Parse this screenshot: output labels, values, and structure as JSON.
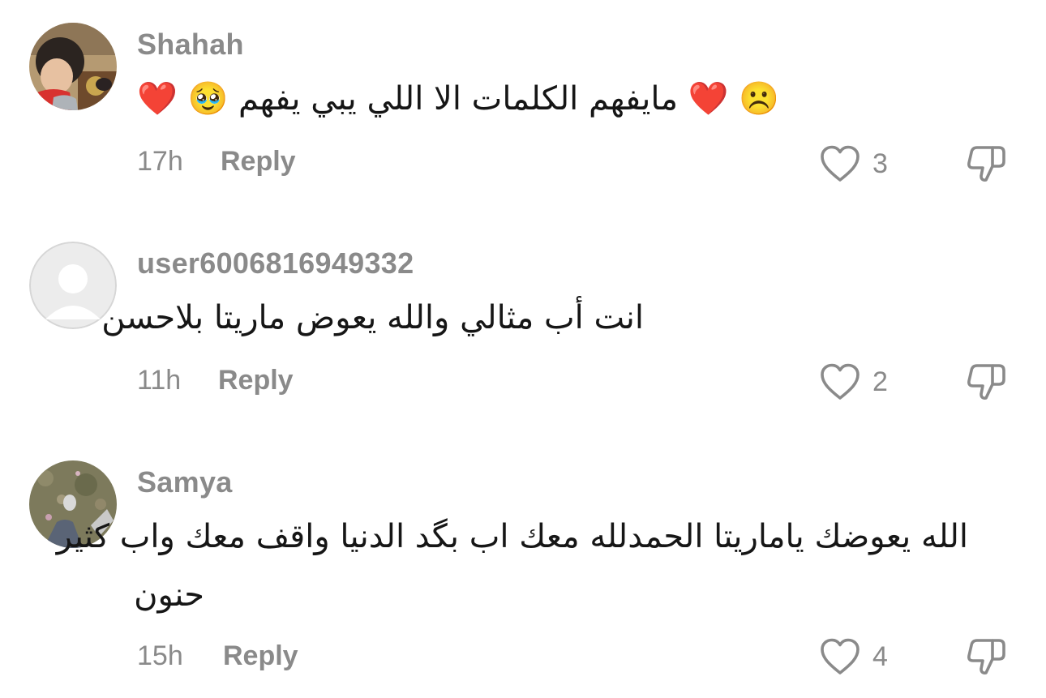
{
  "comments": [
    {
      "username": "Shahah",
      "text": "مايفهم الكلمات الا اللي يبي يفهم",
      "emoji_before": "❤️ 🥹",
      "emoji_after": "❤️ ☹️",
      "time": "17h",
      "reply_label": "Reply",
      "likes": "3",
      "avatar_icon": "child-photo-avatar"
    },
    {
      "username": "user6006816949332",
      "text": "انت أب مثالي والله يعوض ماريتا بلاحسن",
      "time": "11h",
      "reply_label": "Reply",
      "likes": "2",
      "avatar_icon": "default-user-avatar"
    },
    {
      "username": "Samya",
      "text_line1": "الله يعوضك ياماريتا الحمدلله معك اب بگد الدنيا واقف معك واب كثير",
      "text_line2": "حنون",
      "time": "15h",
      "reply_label": "Reply",
      "likes": "4",
      "avatar_icon": "outdoor-photo-avatar"
    }
  ],
  "icons": {
    "like": "heart-outline-icon",
    "dislike": "thumbs-down-outline-icon"
  },
  "colors": {
    "muted": "#8a8a8a",
    "text": "#161616",
    "background": "#ffffff"
  }
}
